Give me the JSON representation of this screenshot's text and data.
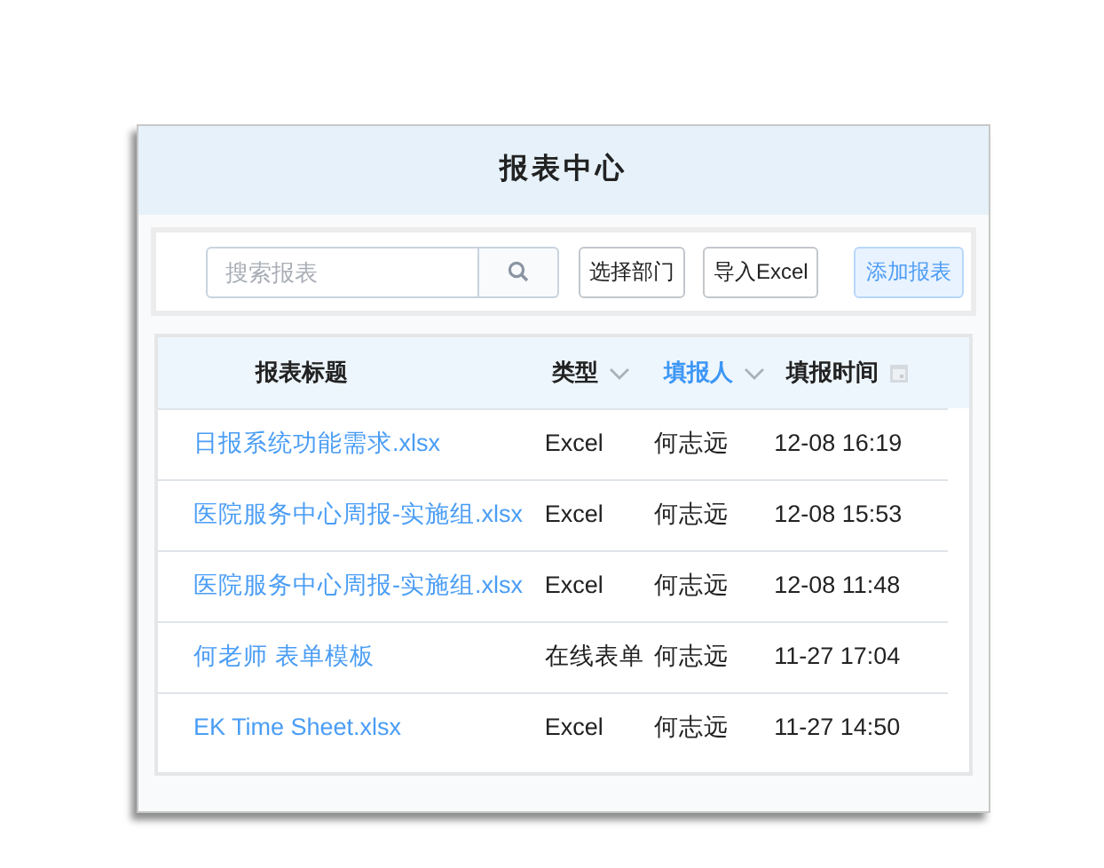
{
  "window": {
    "title": "报表中心"
  },
  "toolbar": {
    "search": {
      "placeholder": "搜索报表"
    },
    "buttons": [
      {
        "label": "选择部门",
        "primary": false
      },
      {
        "label": "导入Excel",
        "primary": false
      },
      {
        "label": "添加报表",
        "primary": true
      }
    ]
  },
  "table": {
    "columns": [
      {
        "label": "报表标题",
        "kind": "plain",
        "highlighted": false
      },
      {
        "label": "类型",
        "kind": "filter",
        "highlighted": false
      },
      {
        "label": "填报人",
        "kind": "filter",
        "highlighted": true
      },
      {
        "label": "填报时间",
        "kind": "date",
        "highlighted": false
      }
    ],
    "rows": [
      [
        "日报系统功能需求.xlsx",
        "Excel",
        "何志远",
        "12-08 16:19"
      ],
      [
        "医院服务中心周报-实施组.xlsx",
        "Excel",
        "何志远",
        "12-08 15:53"
      ],
      [
        "医院服务中心周报-实施组.xlsx",
        "Excel",
        "何志远",
        "12-08 11:48"
      ],
      [
        "何老师 表单模板",
        "在线表单",
        "何志远",
        "11-27 17:04"
      ],
      [
        "EK Time Sheet.xlsx",
        "Excel",
        "何志远",
        "11-27 14:50"
      ]
    ]
  }
}
